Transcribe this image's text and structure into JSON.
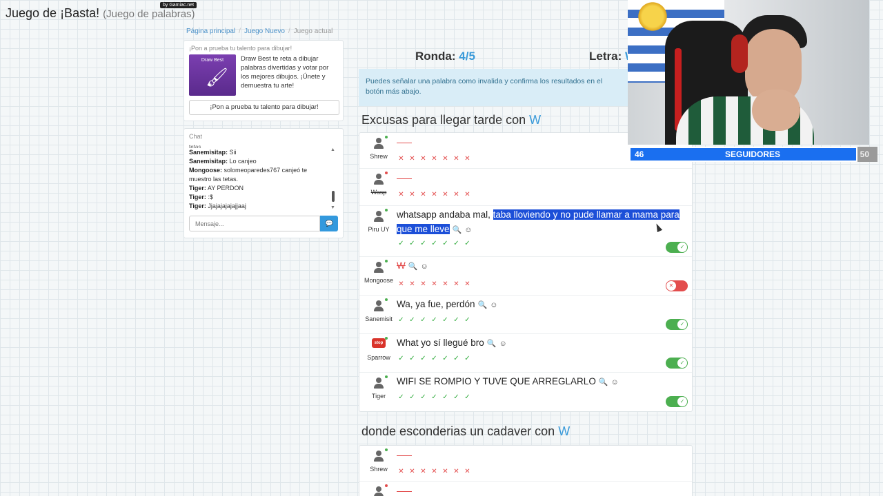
{
  "header": {
    "title": "Juego de ¡Basta!",
    "subtitle": "(Juego de palabras)",
    "badge": "by Gamiac.net"
  },
  "breadcrumb": [
    "Página principal",
    "Juego Nuevo",
    "Juego actual"
  ],
  "promo": {
    "title": "¡Pon a prueba tu talento para dibujar!",
    "thumb_label": "Draw Best",
    "text": "Draw Best te reta a dibujar palabras divertidas y votar por los mejores dibujos. ¡Únete y demuestra tu arte!",
    "button_label": "¡Pon a prueba tu talento para dibujar!"
  },
  "chat": {
    "title": "Chat",
    "cut_line": "tetas.",
    "messages": [
      {
        "user": "Sanemisitap:",
        "text": "Sii"
      },
      {
        "user": "Sanemisitap:",
        "text": "Lo canjeo"
      },
      {
        "user": "Mongoose:",
        "text": "solomeoparedes767 canjeó te muestro las tetas."
      },
      {
        "user": "Tiger:",
        "text": "AY PERDON"
      },
      {
        "user": "Tiger:",
        "text": ":$"
      },
      {
        "user": "Tiger:",
        "text": "Jjajajajajajjaaj"
      }
    ],
    "input_placeholder": "Mensaje..."
  },
  "round": {
    "label": "Ronda:",
    "value": "4/5"
  },
  "letter": {
    "label": "Letra:",
    "value": "W"
  },
  "alert_text": "Puedes señalar una palabra como invalida y confirma los resultados en el botón más abajo.",
  "categories": [
    {
      "title": "Excusas para llegar tarde con",
      "letter": "W",
      "rows": [
        {
          "player": "Shrew",
          "online": true,
          "answer_before": "",
          "answer_highlight": "",
          "valid": null,
          "votes": [
            "x",
            "x",
            "x",
            "x",
            "x",
            "x",
            "x"
          ]
        },
        {
          "player": "Wasp",
          "online": false,
          "answer_before": "",
          "answer_highlight": "",
          "valid": null,
          "votes": [
            "x",
            "x",
            "x",
            "x",
            "x",
            "x",
            "x"
          ]
        },
        {
          "player": "Piru UY",
          "online": true,
          "answer_before": "whatsapp andaba mal, ",
          "answer_highlight": "taba lloviendo y no pude llamar a mama para que me lleve",
          "valid": true,
          "votes": [
            "ok",
            "ok",
            "ok",
            "ok",
            "ok",
            "ok",
            "ok"
          ]
        },
        {
          "player": "Mongoose",
          "online": true,
          "answer_before": "W",
          "answer_highlight": "",
          "valid": false,
          "votes": [
            "x",
            "x",
            "x",
            "x",
            "x",
            "x",
            "x"
          ]
        },
        {
          "player": "Sanemisit",
          "online": true,
          "answer_before": "Wa, ya fue, perdón",
          "answer_highlight": "",
          "valid": true,
          "votes": [
            "ok",
            "ok",
            "ok",
            "ok",
            "ok",
            "ok",
            "ok"
          ]
        },
        {
          "player": "Sparrow",
          "online": true,
          "answer_before": "What yo sí llegué bro",
          "answer_highlight": "",
          "valid": true,
          "votes": [
            "ok",
            "ok",
            "ok",
            "ok",
            "ok",
            "ok",
            "ok"
          ]
        },
        {
          "player": "Tiger",
          "online": true,
          "answer_before": "WIFI SE ROMPIO Y TUVE QUE ARREGLARLO",
          "answer_highlight": "",
          "valid": true,
          "votes": [
            "ok",
            "ok",
            "ok",
            "ok",
            "ok",
            "ok",
            "ok"
          ]
        }
      ]
    },
    {
      "title": "donde esconderias un cadaver con",
      "letter": "W",
      "rows": [
        {
          "player": "Shrew",
          "online": true,
          "answer_before": "",
          "answer_highlight": "",
          "valid": null,
          "votes": [
            "x",
            "x",
            "x",
            "x",
            "x",
            "x",
            "x"
          ]
        }
      ]
    }
  ],
  "stream_overlay": {
    "followers_current": "46",
    "followers_label": "SEGUIDORES",
    "followers_goal": "50",
    "progress": 0.92
  },
  "colors": {
    "accent": "#3a9ad9",
    "valid": "#4caf50",
    "invalid": "#e34d4d",
    "highlight": "#1c4fd8",
    "overlay_bar": "#1a6ff0"
  }
}
